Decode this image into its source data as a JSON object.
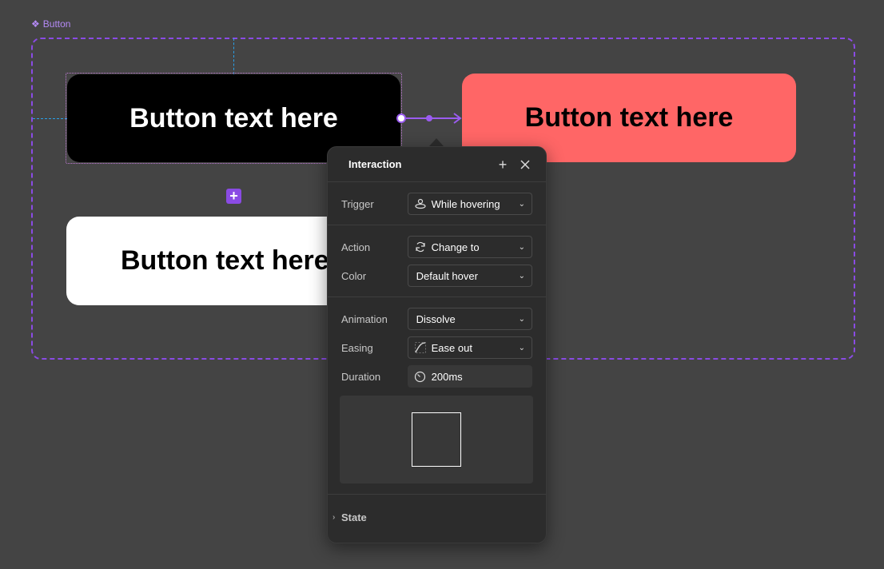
{
  "canvas": {
    "frame_label": "Button",
    "variants": [
      {
        "text": "Button text here"
      },
      {
        "text": "Button text here"
      },
      {
        "text": "Button text here"
      }
    ]
  },
  "panel": {
    "title": "Interaction",
    "trigger": {
      "label": "Trigger",
      "value": "While hovering"
    },
    "action": {
      "label": "Action",
      "value": "Change to"
    },
    "color": {
      "label": "Color",
      "value": "Default hover"
    },
    "animation": {
      "label": "Animation",
      "value": "Dissolve"
    },
    "easing": {
      "label": "Easing",
      "value": "Ease out"
    },
    "duration": {
      "label": "Duration",
      "value": "200ms"
    },
    "state": {
      "label": "State"
    }
  },
  "colors": {
    "canvas_bg": "#444444",
    "accent_purple": "#8a4be4",
    "hover_red": "#ff6666",
    "guide_blue": "#29a0e8",
    "panel_bg": "#2c2c2c"
  }
}
